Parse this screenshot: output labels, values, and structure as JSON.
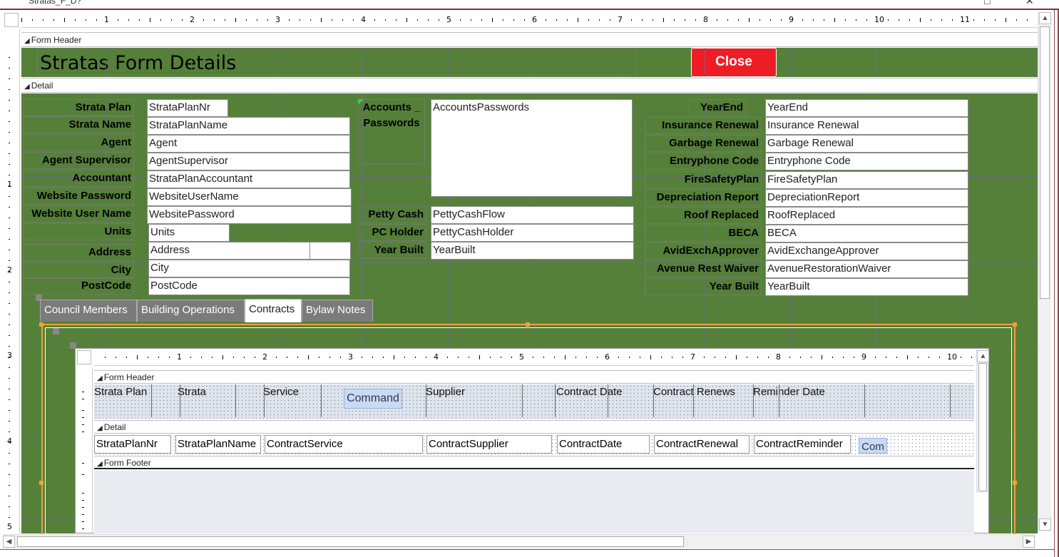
{
  "window": {
    "title": "Stratas_F_D?"
  },
  "ruler_numbers": [
    "1",
    "2",
    "3",
    "4",
    "5",
    "6",
    "7",
    "8",
    "9",
    "10",
    "11"
  ],
  "ruler_left_numbers": [
    "1",
    "2",
    "3",
    "4",
    "5"
  ],
  "sections": {
    "form_header": "Form Header",
    "detail": "Detail"
  },
  "form_header": {
    "title": "Stratas Form Details",
    "close_label": "Close"
  },
  "left_column": [
    {
      "label": "Strata Plan",
      "field": "StrataPlanNr"
    },
    {
      "label": "Strata Name",
      "field": "StrataPlanName"
    },
    {
      "label": "Agent",
      "field": "Agent"
    },
    {
      "label": "Agent Supervisor",
      "field": "AgentSupervisor"
    },
    {
      "label": "Accountant",
      "field": "StrataPlanAccountant"
    },
    {
      "label": "Website Password",
      "field": "WebsiteUserName"
    },
    {
      "label": "Website User Name",
      "field": "WebsitePassword"
    },
    {
      "label": "Units",
      "field": "Units"
    },
    {
      "label": "Address",
      "field": "Address"
    },
    {
      "label": "City",
      "field": "City"
    },
    {
      "label": "PostCode",
      "field": "PostCode"
    }
  ],
  "middle_column": {
    "accounts_label": "Accounts _ Passwords",
    "accounts_field": "AccountsPasswords",
    "rows": [
      {
        "label": "Petty Cash",
        "field": "PettyCashFlow"
      },
      {
        "label": "PC Holder",
        "field": "PettyCashHolder"
      },
      {
        "label": "Year Built",
        "field": "YearBuilt"
      }
    ]
  },
  "right_column": [
    {
      "label": "YearEnd",
      "field": "YearEnd"
    },
    {
      "label": "Insurance Renewal",
      "field": "Insurance Renewal"
    },
    {
      "label": "Garbage Renewal",
      "field": "Garbage Renewal"
    },
    {
      "label": "Entryphone Code",
      "field": "Entryphone Code"
    },
    {
      "label": "FireSafetyPlan",
      "field": "FireSafetyPlan"
    },
    {
      "label": "Depreciation Report",
      "field": "DepreciationReport"
    },
    {
      "label": "Roof Replaced",
      "field": "RoofReplaced"
    },
    {
      "label": "BECA",
      "field": "BECA"
    },
    {
      "label": "AvidExchApprover",
      "field": "AvidExchangeApprover"
    },
    {
      "label": "Avenue Rest Waiver",
      "field": "AvenueRestorationWaiver"
    },
    {
      "label": "Year Built",
      "field": "YearBuilt"
    }
  ],
  "tabs": [
    "Council Members",
    "Building Operations",
    "Contracts",
    "Bylaw Notes"
  ],
  "active_tab": "Contracts",
  "subform": {
    "sections": {
      "form_header": "Form Header",
      "detail": "Detail",
      "form_footer": "Form Footer"
    },
    "ruler_numbers": [
      "1",
      "2",
      "3",
      "4",
      "5",
      "6",
      "7",
      "8",
      "9",
      "10"
    ],
    "header_labels": [
      "Strata Plan",
      "Strata",
      "Service",
      "Supplier",
      "Contract Date",
      "Contract Renews",
      "Reminder Date"
    ],
    "command_label": "Command",
    "detail_fields": [
      "StrataPlanNr",
      "StrataPlanName",
      "ContractService",
      "ContractSupplier",
      "ContractDate",
      "ContractRenewal",
      "ContractReminder"
    ],
    "detail_command_label": "Com"
  },
  "colors": {
    "form_background": "#55803a",
    "close_button": "#ee1c25",
    "selection_border": "#f2a13a"
  }
}
